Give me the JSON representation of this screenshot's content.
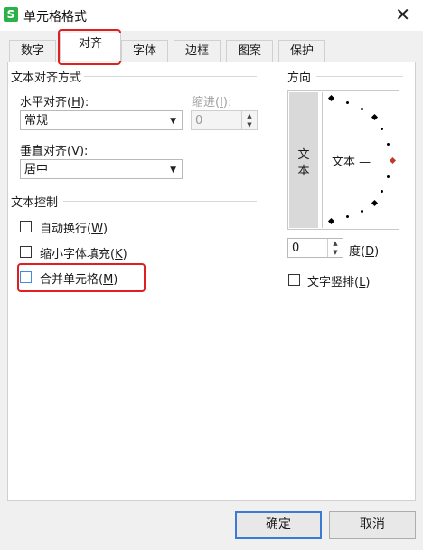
{
  "window": {
    "title": "单元格格式",
    "app_icon_glyph": "S",
    "close_glyph": "✕"
  },
  "tabs": [
    {
      "label": "数字"
    },
    {
      "label": "对齐"
    },
    {
      "label": "字体"
    },
    {
      "label": "边框"
    },
    {
      "label": "图案"
    },
    {
      "label": "保护"
    }
  ],
  "active_tab": "对齐",
  "text_alignment": {
    "group_label": "文本对齐方式",
    "horizontal": {
      "label": "水平对齐(",
      "key": "H",
      "label_tail": "):",
      "value": "常规"
    },
    "indent": {
      "label": "缩进(",
      "key": "I",
      "label_tail": "):",
      "value": "0"
    },
    "vertical": {
      "label": "垂直对齐(",
      "key": "V",
      "label_tail": "):",
      "value": "居中"
    }
  },
  "text_control": {
    "group_label": "文本控制",
    "wrap": {
      "label": "自动换行(",
      "key": "W",
      "tail": ")",
      "checked": false
    },
    "shrink": {
      "label": "缩小字体填充(",
      "key": "K",
      "tail": ")",
      "checked": false
    },
    "merge": {
      "label": "合并单元格(",
      "key": "M",
      "tail": ")",
      "checked": false
    }
  },
  "orientation": {
    "group_label": "方向",
    "vertical_text_1": "文",
    "vertical_text_2": "本",
    "dial_text": "文本 —",
    "degrees_value": "0",
    "degrees_label": "度(",
    "degrees_key": "D",
    "degrees_tail": ")",
    "vertical_text_checkbox": {
      "label": "文字竖排(",
      "key": "L",
      "tail": ")",
      "checked": false
    }
  },
  "buttons": {
    "ok": "确定",
    "cancel": "取消"
  },
  "colors": {
    "highlight": "#e02020",
    "app_icon": "#2ab24a",
    "primary_border": "#3a7bd5"
  }
}
